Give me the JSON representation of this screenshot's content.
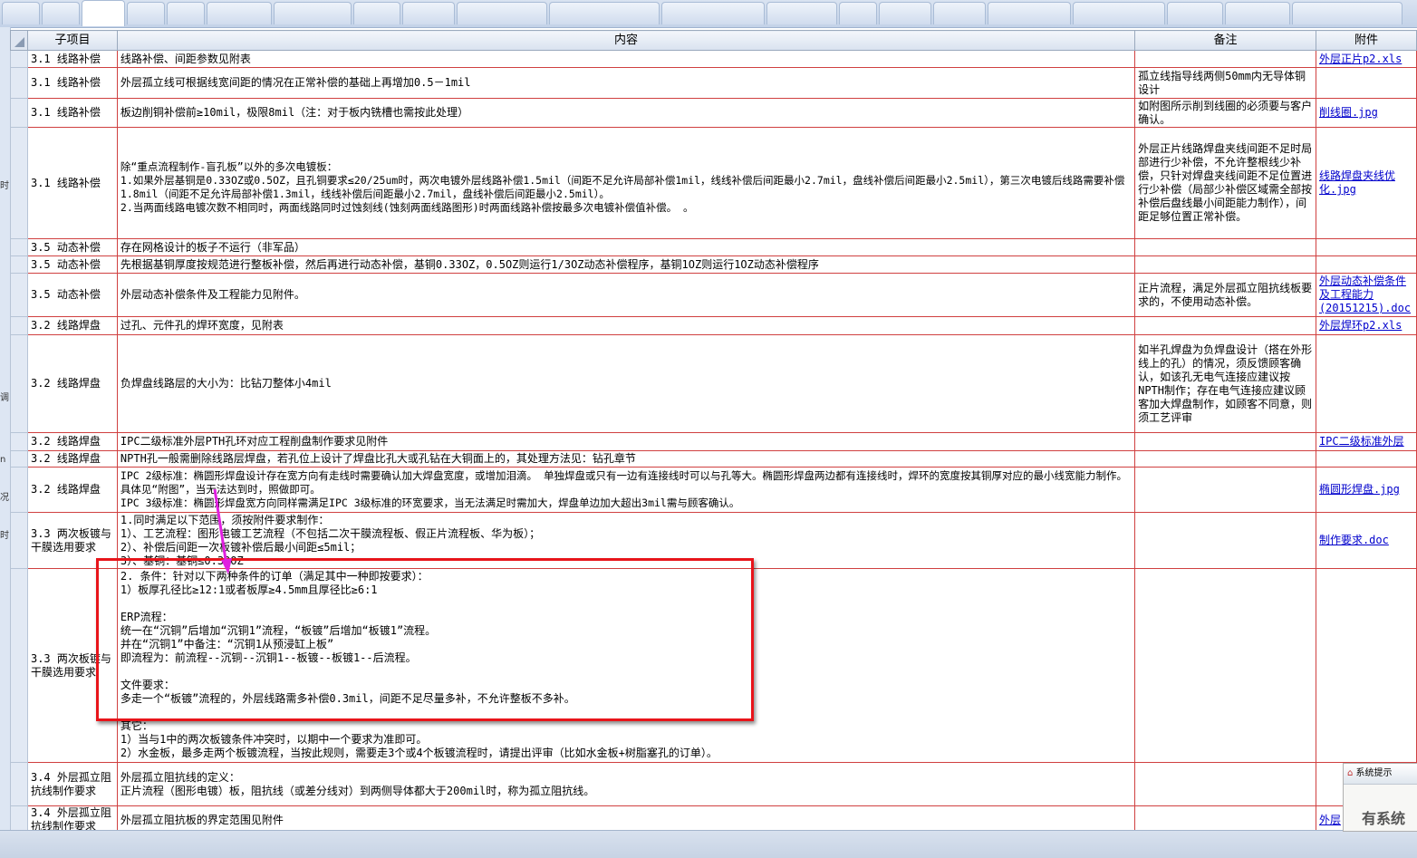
{
  "header": {
    "sub": "子项目",
    "content": "内容",
    "note": "备注",
    "att": "附件"
  },
  "rows": [
    {
      "sub": "3.1 线路补偿",
      "content": "线路补偿、间距参数见附表",
      "note": "",
      "att": "外层正片p2.xls"
    },
    {
      "sub": "3.1 线路补偿",
      "content": "外层孤立线可根据线宽间距的情况在正常补偿的基础上再增加0.5－1mil",
      "note": "孤立线指导线两侧50mm内无导体铜设计",
      "att": ""
    },
    {
      "sub": "3.1 线路补偿",
      "content": "板边削铜补偿前≥10mil，极限8mil（注：对于板内铣槽也需按此处理）",
      "note": "如附图所示削到线圈的必须要与客户确认。",
      "att": "削线圈.jpg"
    },
    {
      "sub": "3.1 线路补偿",
      "content": "除“重点流程制作-盲孔板”以外的多次电镀板：\n1.如果外层基铜是0.33OZ或0.5OZ，且孔铜要求≤20/25um时，两次电镀外层线路补偿1.5mil（间距不足允许局部补偿1mil，线线补偿后间距最小2.7mil，盘线补偿后间距最小2.5mil），第三次电镀后线路需要补偿1.8mil（间距不足允许局部补偿1.3mil，线线补偿后间距最小2.7mil，盘线补偿后间距最小2.5mil）。\n2.当两面线路电镀次数不相同时，两面线路同时过蚀刻线(蚀刻两面线路图形)时两面线路补偿按最多次电镀补偿值补偿。 。",
      "note": "外层正片线路焊盘夹线间距不足时局部进行少补偿，不允许整根线少补偿，只针对焊盘夹线间距不足位置进行少补偿（局部少补偿区域需全部按补偿后盘线最小间距能力制作），间距足够位置正常补偿。",
      "att": "线路焊盘夹线优化.jpg"
    },
    {
      "sub": "3.5 动态补偿",
      "content": "存在网格设计的板子不运行（非军品）",
      "note": "",
      "att": ""
    },
    {
      "sub": "3.5 动态补偿",
      "content": "先根据基铜厚度按规范进行整板补偿，然后再进行动态补偿，基铜0.33OZ，0.5OZ则运行1/3OZ动态补偿程序，基铜1OZ则运行1OZ动态补偿程序",
      "note": "",
      "att": ""
    },
    {
      "sub": "3.5 动态补偿",
      "content": "外层动态补偿条件及工程能力见附件。",
      "note": "正片流程，满足外层孤立阻抗线板要求的，不使用动态补偿。",
      "att": "外层动态补偿条件及工程能力(20151215).doc"
    },
    {
      "sub": "3.2 线路焊盘",
      "content": "过孔、元件孔的焊环宽度，见附表",
      "note": "",
      "att": "外层焊环p2.xls"
    },
    {
      "sub": "3.2 线路焊盘",
      "content": "负焊盘线路层的大小为：比钻刀整体小4mil",
      "note": "如半孔焊盘为负焊盘设计（搭在外形线上的孔）的情况，须反馈顾客确认，如该孔无电气连接应建议按NPTH制作；存在电气连接应建议顾客加大焊盘制作，如顾客不同意，则须工艺评审",
      "att": ""
    },
    {
      "sub": "3.2 线路焊盘",
      "content": "IPC二级标准外层PTH孔环对应工程削盘制作要求见附件",
      "note": "",
      "att": "IPC二级标准外层"
    },
    {
      "sub": "3.2 线路焊盘",
      "content": "NPTH孔一般需删除线路层焊盘，若孔位上设计了焊盘比孔大或孔钻在大铜面上的，其处理方法见：钻孔章节",
      "note": "",
      "att": ""
    },
    {
      "sub": "3.2 线路焊盘",
      "content": "IPC 2级标准：椭圆形焊盘设计存在宽方向有走线时需要确认加大焊盘宽度，或增加泪滴。 单独焊盘或只有一边有连接线时可以与孔等大。椭圆形焊盘两边都有连接线时，焊环的宽度按其铜厚对应的最小线宽能力制作。具体见“附图”，当无法达到时，照做即可。\nIPC 3级标准：椭圆形焊盘宽方向同样需满足IPC 3级标准的环宽要求，当无法满足时需加大，焊盘单边加大超出3mil需与顾客确认。",
      "note": "",
      "att": "椭圆形焊盘.jpg"
    },
    {
      "sub": "3.3 两次板镀与干膜选用要求",
      "content": "1.同时满足以下范围，须按附件要求制作：\n1）、工艺流程：图形电镀工艺流程（不包括二次干膜流程板、假正片流程板、华为板）；\n2）、补偿后间距一次板镀补偿后最小间距≤5mil；\n3）、基铜：基铜≤0.33OZ",
      "note": "",
      "att": "制作要求.doc"
    },
    {
      "sub": "3.3 两次板镀与干膜选用要求",
      "content": "2. 条件：针对以下两种条件的订单（满足其中一种即按要求）：\n1）板厚孔径比≥12:1或者板厚≥4.5mm且厚径比≥6:1\n\nERP流程：\n统一在“沉铜”后增加“沉铜1”流程，“板镀”后增加“板镀1”流程。\n并在“沉铜1”中备注：“沉铜1从预浸缸上板”\n即流程为：前流程--沉铜--沉铜1--板镀--板镀1--后流程。\n\n文件要求：\n多走一个“板镀”流程的，外层线路需多补偿0.3mil，间距不足尽量多补，不允许整板不多补。\n\n其它：\n1）当与1中的两次板镀条件冲突时，以期中一个要求为准即可。\n2）水金板，最多走两个板镀流程，当按此规则，需要走3个或4个板镀流程时，请提出评审（比如水金板+树脂塞孔的订单）。",
      "note": "",
      "att": ""
    },
    {
      "sub": "3.4 外层孤立阻抗线制作要求",
      "content": "外层孤立阻抗线的定义：\n正片流程（图形电镀）板，阻抗线（或差分线对）到两侧导体都大于200mil时，称为孤立阻抗线。",
      "note": "",
      "att": ""
    },
    {
      "sub": "3.4 外层孤立阻抗线制作要求",
      "content": "外层孤立阻抗板的界定范围见附件",
      "note": "",
      "att": "外层"
    }
  ],
  "left_glyphs": [
    "时",
    "调",
    "n",
    "况",
    "时"
  ],
  "popup": {
    "title": "系统提示",
    "body": "有系统"
  },
  "colors": {
    "grid_line": "#d04040",
    "highlight": "#e8141a",
    "arrow": "#e020e0",
    "link": "#0000cc"
  }
}
